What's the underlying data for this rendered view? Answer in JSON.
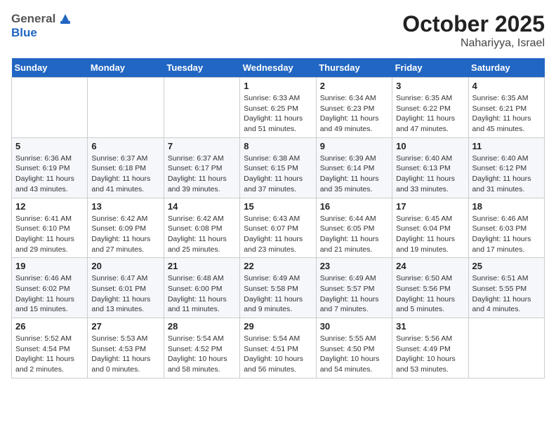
{
  "header": {
    "logo_general": "General",
    "logo_blue": "Blue",
    "month_title": "October 2025",
    "location": "Nahariyya, Israel"
  },
  "weekdays": [
    "Sunday",
    "Monday",
    "Tuesday",
    "Wednesday",
    "Thursday",
    "Friday",
    "Saturday"
  ],
  "weeks": [
    [
      {
        "day": "",
        "info": ""
      },
      {
        "day": "",
        "info": ""
      },
      {
        "day": "",
        "info": ""
      },
      {
        "day": "1",
        "info": "Sunrise: 6:33 AM\nSunset: 6:25 PM\nDaylight: 11 hours\nand 51 minutes."
      },
      {
        "day": "2",
        "info": "Sunrise: 6:34 AM\nSunset: 6:23 PM\nDaylight: 11 hours\nand 49 minutes."
      },
      {
        "day": "3",
        "info": "Sunrise: 6:35 AM\nSunset: 6:22 PM\nDaylight: 11 hours\nand 47 minutes."
      },
      {
        "day": "4",
        "info": "Sunrise: 6:35 AM\nSunset: 6:21 PM\nDaylight: 11 hours\nand 45 minutes."
      }
    ],
    [
      {
        "day": "5",
        "info": "Sunrise: 6:36 AM\nSunset: 6:19 PM\nDaylight: 11 hours\nand 43 minutes."
      },
      {
        "day": "6",
        "info": "Sunrise: 6:37 AM\nSunset: 6:18 PM\nDaylight: 11 hours\nand 41 minutes."
      },
      {
        "day": "7",
        "info": "Sunrise: 6:37 AM\nSunset: 6:17 PM\nDaylight: 11 hours\nand 39 minutes."
      },
      {
        "day": "8",
        "info": "Sunrise: 6:38 AM\nSunset: 6:15 PM\nDaylight: 11 hours\nand 37 minutes."
      },
      {
        "day": "9",
        "info": "Sunrise: 6:39 AM\nSunset: 6:14 PM\nDaylight: 11 hours\nand 35 minutes."
      },
      {
        "day": "10",
        "info": "Sunrise: 6:40 AM\nSunset: 6:13 PM\nDaylight: 11 hours\nand 33 minutes."
      },
      {
        "day": "11",
        "info": "Sunrise: 6:40 AM\nSunset: 6:12 PM\nDaylight: 11 hours\nand 31 minutes."
      }
    ],
    [
      {
        "day": "12",
        "info": "Sunrise: 6:41 AM\nSunset: 6:10 PM\nDaylight: 11 hours\nand 29 minutes."
      },
      {
        "day": "13",
        "info": "Sunrise: 6:42 AM\nSunset: 6:09 PM\nDaylight: 11 hours\nand 27 minutes."
      },
      {
        "day": "14",
        "info": "Sunrise: 6:42 AM\nSunset: 6:08 PM\nDaylight: 11 hours\nand 25 minutes."
      },
      {
        "day": "15",
        "info": "Sunrise: 6:43 AM\nSunset: 6:07 PM\nDaylight: 11 hours\nand 23 minutes."
      },
      {
        "day": "16",
        "info": "Sunrise: 6:44 AM\nSunset: 6:05 PM\nDaylight: 11 hours\nand 21 minutes."
      },
      {
        "day": "17",
        "info": "Sunrise: 6:45 AM\nSunset: 6:04 PM\nDaylight: 11 hours\nand 19 minutes."
      },
      {
        "day": "18",
        "info": "Sunrise: 6:46 AM\nSunset: 6:03 PM\nDaylight: 11 hours\nand 17 minutes."
      }
    ],
    [
      {
        "day": "19",
        "info": "Sunrise: 6:46 AM\nSunset: 6:02 PM\nDaylight: 11 hours\nand 15 minutes."
      },
      {
        "day": "20",
        "info": "Sunrise: 6:47 AM\nSunset: 6:01 PM\nDaylight: 11 hours\nand 13 minutes."
      },
      {
        "day": "21",
        "info": "Sunrise: 6:48 AM\nSunset: 6:00 PM\nDaylight: 11 hours\nand 11 minutes."
      },
      {
        "day": "22",
        "info": "Sunrise: 6:49 AM\nSunset: 5:58 PM\nDaylight: 11 hours\nand 9 minutes."
      },
      {
        "day": "23",
        "info": "Sunrise: 6:49 AM\nSunset: 5:57 PM\nDaylight: 11 hours\nand 7 minutes."
      },
      {
        "day": "24",
        "info": "Sunrise: 6:50 AM\nSunset: 5:56 PM\nDaylight: 11 hours\nand 5 minutes."
      },
      {
        "day": "25",
        "info": "Sunrise: 6:51 AM\nSunset: 5:55 PM\nDaylight: 11 hours\nand 4 minutes."
      }
    ],
    [
      {
        "day": "26",
        "info": "Sunrise: 5:52 AM\nSunset: 4:54 PM\nDaylight: 11 hours\nand 2 minutes."
      },
      {
        "day": "27",
        "info": "Sunrise: 5:53 AM\nSunset: 4:53 PM\nDaylight: 11 hours\nand 0 minutes."
      },
      {
        "day": "28",
        "info": "Sunrise: 5:54 AM\nSunset: 4:52 PM\nDaylight: 10 hours\nand 58 minutes."
      },
      {
        "day": "29",
        "info": "Sunrise: 5:54 AM\nSunset: 4:51 PM\nDaylight: 10 hours\nand 56 minutes."
      },
      {
        "day": "30",
        "info": "Sunrise: 5:55 AM\nSunset: 4:50 PM\nDaylight: 10 hours\nand 54 minutes."
      },
      {
        "day": "31",
        "info": "Sunrise: 5:56 AM\nSunset: 4:49 PM\nDaylight: 10 hours\nand 53 minutes."
      },
      {
        "day": "",
        "info": ""
      }
    ]
  ]
}
